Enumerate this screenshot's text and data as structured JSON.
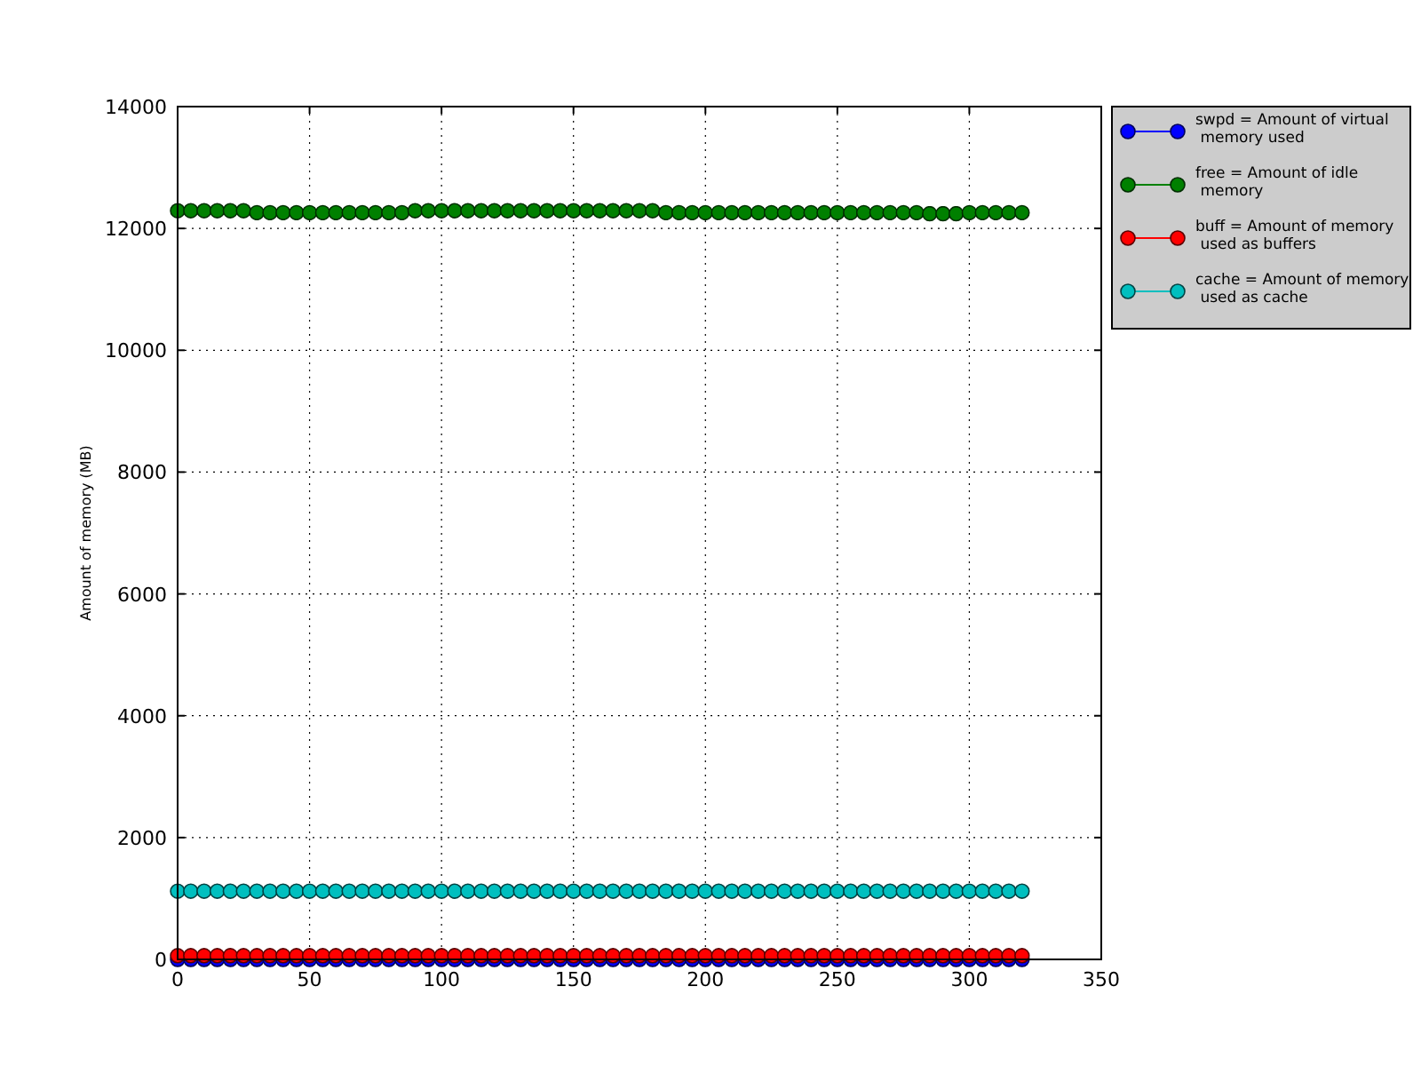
{
  "chart_data": {
    "type": "line",
    "grid": true,
    "legend": true,
    "ylabel": "Amount of memory (MB)",
    "xlim": [
      0,
      350
    ],
    "ylim": [
      0,
      14000
    ],
    "xticks": [
      0,
      50,
      100,
      150,
      200,
      250,
      300,
      350
    ],
    "yticks": [
      0,
      2000,
      4000,
      6000,
      8000,
      10000,
      12000,
      14000
    ],
    "x": [
      0,
      5,
      10,
      15,
      20,
      25,
      30,
      35,
      40,
      45,
      50,
      55,
      60,
      65,
      70,
      75,
      80,
      85,
      90,
      95,
      100,
      105,
      110,
      115,
      120,
      125,
      130,
      135,
      140,
      145,
      150,
      155,
      160,
      165,
      170,
      175,
      180,
      185,
      190,
      195,
      200,
      205,
      210,
      215,
      220,
      225,
      230,
      235,
      240,
      245,
      250,
      255,
      260,
      265,
      270,
      275,
      280,
      285,
      290,
      295,
      300,
      305,
      310,
      315,
      320
    ],
    "series": [
      {
        "name": "swpd = Amount of virtual\n memory used",
        "color": "#0000ff",
        "values": [
          0,
          0,
          0,
          0,
          0,
          0,
          0,
          0,
          0,
          0,
          0,
          0,
          0,
          0,
          0,
          0,
          0,
          0,
          0,
          0,
          0,
          0,
          0,
          0,
          0,
          0,
          0,
          0,
          0,
          0,
          0,
          0,
          0,
          0,
          0,
          0,
          0,
          0,
          0,
          0,
          0,
          0,
          0,
          0,
          0,
          0,
          0,
          0,
          0,
          0,
          0,
          0,
          0,
          0,
          0,
          0,
          0,
          0,
          0,
          0,
          0,
          0,
          0,
          0,
          0
        ]
      },
      {
        "name": "free = Amount of idle\n memory",
        "color": "#008000",
        "values": [
          12290,
          12290,
          12290,
          12290,
          12290,
          12290,
          12260,
          12260,
          12260,
          12260,
          12260,
          12260,
          12260,
          12260,
          12260,
          12260,
          12260,
          12260,
          12290,
          12290,
          12290,
          12290,
          12290,
          12290,
          12290,
          12290,
          12290,
          12290,
          12290,
          12290,
          12290,
          12290,
          12290,
          12290,
          12290,
          12290,
          12290,
          12260,
          12260,
          12260,
          12260,
          12260,
          12260,
          12260,
          12260,
          12260,
          12260,
          12260,
          12260,
          12260,
          12260,
          12260,
          12260,
          12260,
          12260,
          12260,
          12260,
          12240,
          12240,
          12240,
          12260,
          12260,
          12260,
          12260,
          12260
        ]
      },
      {
        "name": "buff = Amount of memory\n used as buffers",
        "color": "#ff0000",
        "values": [
          60,
          60,
          60,
          60,
          60,
          60,
          60,
          60,
          60,
          60,
          60,
          60,
          60,
          60,
          60,
          60,
          60,
          60,
          60,
          60,
          60,
          60,
          60,
          60,
          60,
          60,
          60,
          60,
          60,
          60,
          60,
          60,
          60,
          60,
          60,
          60,
          60,
          60,
          60,
          60,
          60,
          60,
          60,
          60,
          60,
          60,
          60,
          60,
          60,
          60,
          60,
          60,
          60,
          60,
          60,
          60,
          60,
          60,
          60,
          60,
          60,
          60,
          60,
          60,
          60
        ]
      },
      {
        "name": "cache = Amount of memory\n used as cache",
        "color": "#00bfbf",
        "values": [
          1120,
          1120,
          1120,
          1120,
          1120,
          1120,
          1120,
          1120,
          1120,
          1120,
          1120,
          1120,
          1120,
          1120,
          1120,
          1120,
          1120,
          1120,
          1120,
          1120,
          1120,
          1120,
          1120,
          1120,
          1120,
          1120,
          1120,
          1120,
          1120,
          1120,
          1120,
          1120,
          1120,
          1120,
          1120,
          1120,
          1120,
          1120,
          1120,
          1120,
          1120,
          1120,
          1120,
          1120,
          1120,
          1120,
          1120,
          1120,
          1120,
          1120,
          1120,
          1120,
          1120,
          1120,
          1120,
          1120,
          1120,
          1120,
          1120,
          1120,
          1120,
          1120,
          1120,
          1120,
          1120
        ]
      }
    ]
  }
}
